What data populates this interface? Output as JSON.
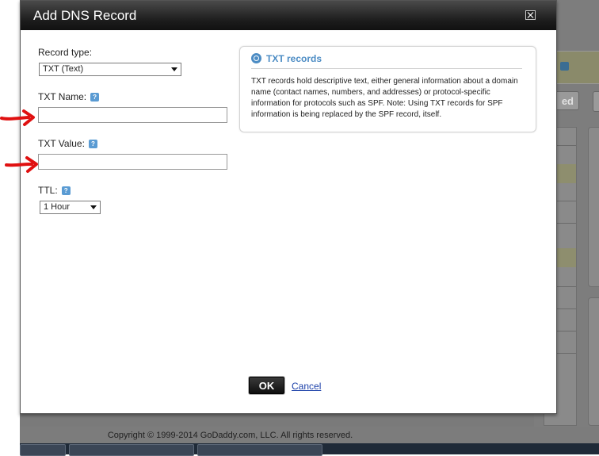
{
  "dialog": {
    "title": "Add DNS Record",
    "close_icon": "close-icon"
  },
  "form": {
    "record_type": {
      "label": "Record type:",
      "selected": "TXT (Text)"
    },
    "txt_name": {
      "label": "TXT Name:",
      "value": ""
    },
    "txt_value": {
      "label": "TXT Value:",
      "value": ""
    },
    "ttl": {
      "label": "TTL:",
      "selected": "1 Hour"
    }
  },
  "info_box": {
    "title": "TXT records",
    "text": "TXT records hold descriptive text, either general information about a domain name (contact names, numbers, and addresses) or protocol-specific information for protocols such as SPF. Note: Using TXT records for SPF information is being replaced by the SPF record, itself."
  },
  "actions": {
    "ok_label": "OK",
    "cancel_label": "Cancel"
  },
  "footer": {
    "copyright": "Copyright © 1999-2014 GoDaddy.com, LLC. All rights reserved."
  },
  "background": {
    "button_label": "ed"
  },
  "colors": {
    "annotation_arrow": "#e01010",
    "help_badge": "#5a9bd3",
    "info_title": "#4c8cc4"
  }
}
